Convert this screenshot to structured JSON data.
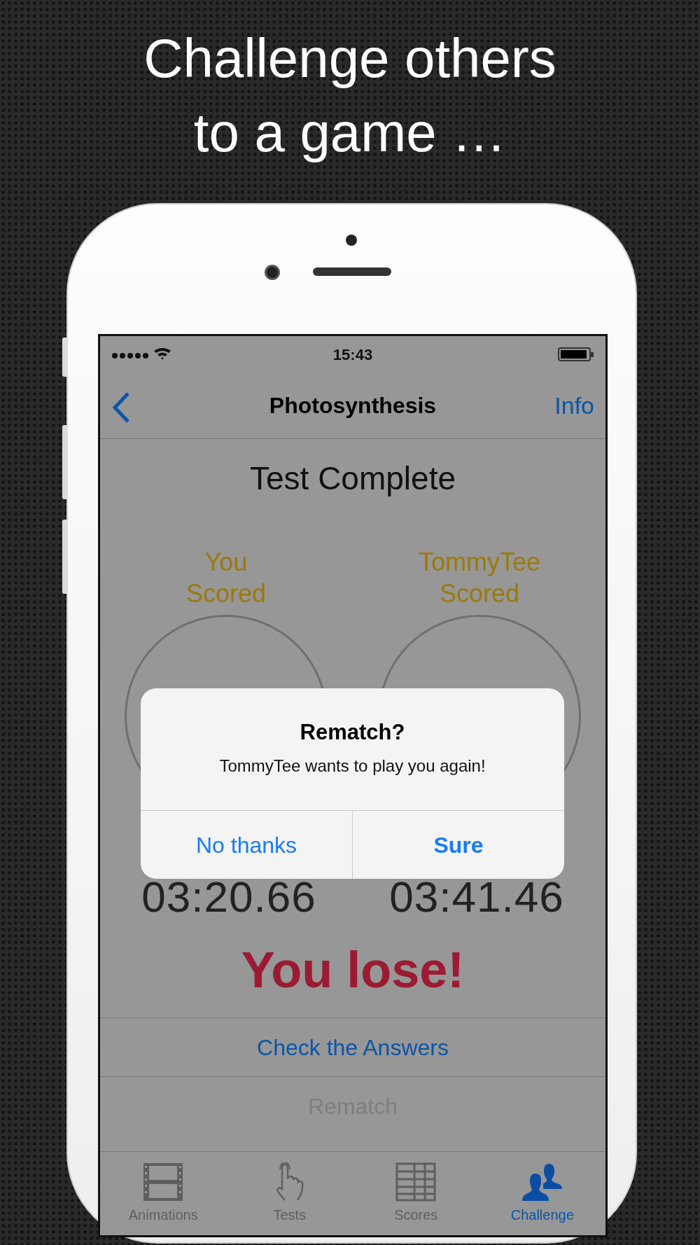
{
  "headline": [
    "Challenge others",
    "to a game …"
  ],
  "status_bar": {
    "time": "15:43"
  },
  "nav": {
    "title": "Photosynthesis",
    "right_button": "Info"
  },
  "heading": "Test Complete",
  "players": [
    {
      "label": "You\nScored",
      "time": "03:20.66"
    },
    {
      "label": "TommyTee\nScored",
      "time": "03:41.46"
    }
  ],
  "result": "You lose!",
  "actions": [
    {
      "label": "Check the Answers",
      "disabled": false
    },
    {
      "label": "Rematch",
      "disabled": true
    }
  ],
  "tabs": [
    {
      "label": "Animations",
      "selected": false
    },
    {
      "label": "Tests",
      "selected": false
    },
    {
      "label": "Scores",
      "selected": false
    },
    {
      "label": "Challenge",
      "selected": true
    }
  ],
  "alert": {
    "title": "Rematch?",
    "message": "TommyTee wants to play you again!",
    "buttons": [
      {
        "label": "No thanks",
        "preferred": false
      },
      {
        "label": "Sure",
        "preferred": true
      }
    ]
  }
}
